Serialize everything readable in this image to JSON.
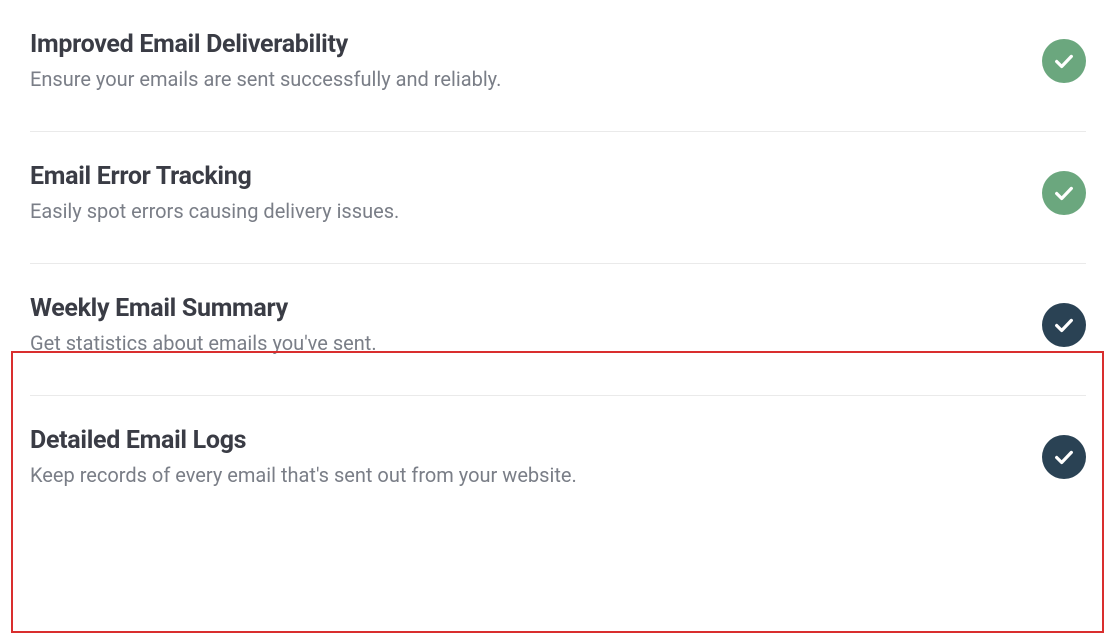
{
  "features": [
    {
      "title": "Improved Email Deliverability",
      "desc": "Ensure your emails are sent successfully and reliably.",
      "badge_color": "green"
    },
    {
      "title": "Email Error Tracking",
      "desc": "Easily spot errors causing delivery issues.",
      "badge_color": "green"
    },
    {
      "title": "Weekly Email Summary",
      "desc": "Get statistics about emails you've sent.",
      "badge_color": "navy"
    },
    {
      "title": "Detailed Email Logs",
      "desc": "Keep records of every email that's sent out from your website.",
      "badge_color": "navy"
    }
  ]
}
